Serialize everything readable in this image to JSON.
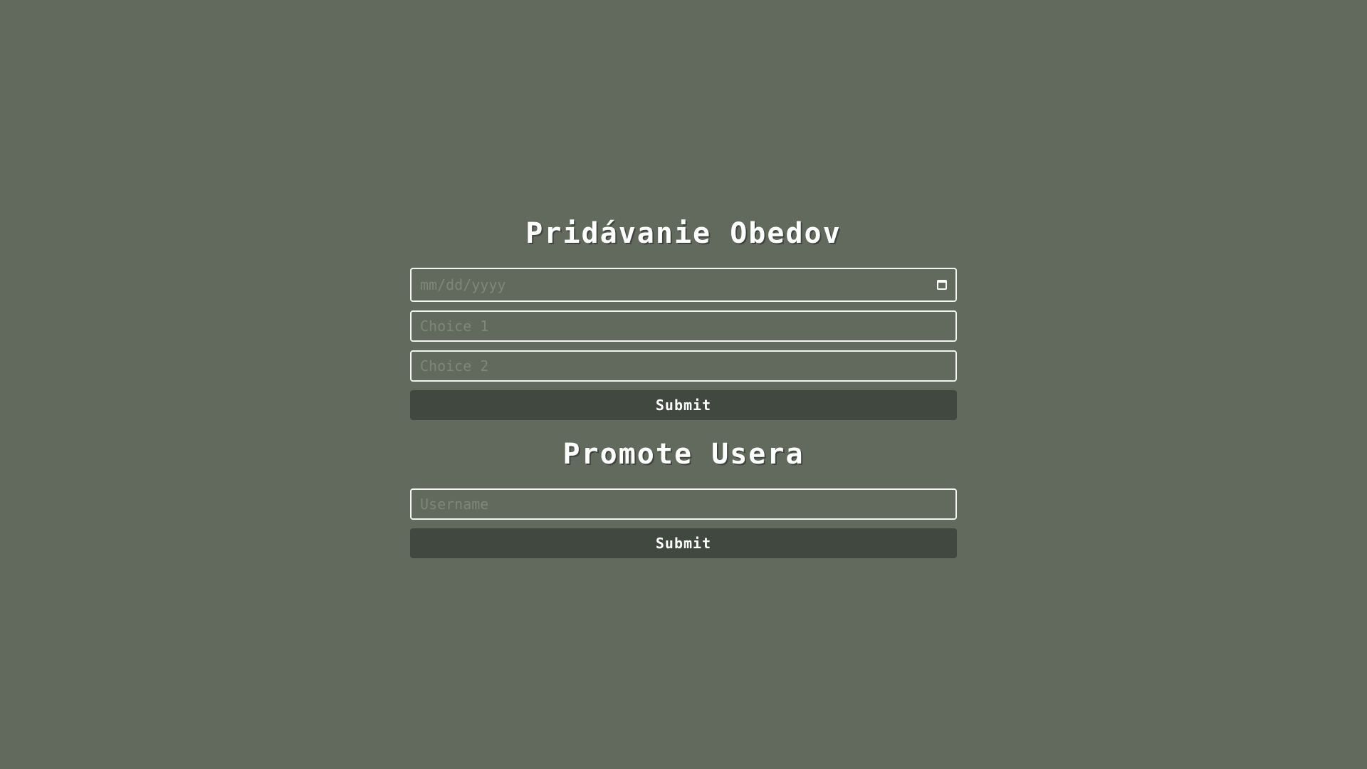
{
  "lunch_form": {
    "title": "Pridávanie Obedov",
    "date_placeholder": "mm/dd/yyyy",
    "choice1_placeholder": "Choice 1",
    "choice2_placeholder": "Choice 2",
    "submit_label": "Submit"
  },
  "promote_form": {
    "title": "Promote Usera",
    "username_placeholder": "Username",
    "submit_label": "Submit"
  },
  "colors": {
    "background": "#616a5d",
    "button": "#414840",
    "text": "#ffffff",
    "placeholder": "#7e877a"
  },
  "icons": {
    "date_picker": "calendar-icon"
  }
}
